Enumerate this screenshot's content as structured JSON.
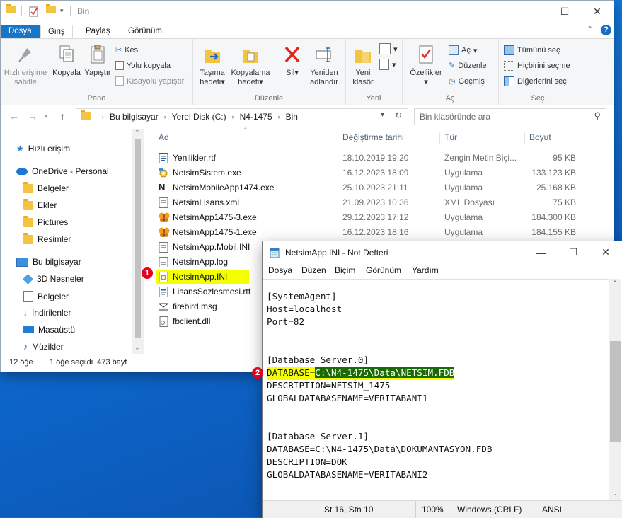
{
  "explorer": {
    "title": "Bin",
    "tabs": [
      "Dosya",
      "Giriş",
      "Paylaş",
      "Görünüm"
    ],
    "ribbon": {
      "pano": {
        "name": "Pano",
        "pin": "Hızlı erişime sabitle",
        "copy": "Kopyala",
        "paste": "Yapıştır",
        "cut": "Kes",
        "copy_path": "Yolu kopyala",
        "paste_shortcut": "Kısayolu yapıştır"
      },
      "duzenle": {
        "name": "Düzenle",
        "move_to": "Taşıma hedefi",
        "copy_to": "Kopyalama hedefi",
        "delete": "Sil",
        "rename": "Yeniden adlandır"
      },
      "yeni": {
        "name": "Yeni",
        "new_folder": "Yeni klasör"
      },
      "ac": {
        "name": "Aç",
        "properties": "Özellikler",
        "open": "Aç",
        "edit": "Düzenle",
        "history": "Geçmiş"
      },
      "sec": {
        "name": "Seç",
        "select_all": "Tümünü seç",
        "select_none": "Hiçbirini seçme",
        "invert": "Diğerlerini seç"
      }
    },
    "address": [
      "Bu bilgisayar",
      "Yerel Disk (C:)",
      "N4-1475",
      "Bin"
    ],
    "search_placeholder": "Bin klasöründe ara",
    "nav": {
      "quick": "Hızlı erişim",
      "onedrive": "OneDrive - Personal",
      "onedrive_items": [
        "Belgeler",
        "Ekler",
        "Pictures",
        "Resimler"
      ],
      "pc": "Bu bilgisayar",
      "pc_items": [
        "3D Nesneler",
        "Belgeler",
        "İndirilenler",
        "Masaüstü",
        "Müzikler"
      ]
    },
    "columns": {
      "name": "Ad",
      "date": "Değiştirme tarihi",
      "type": "Tür",
      "size": "Boyut"
    },
    "files": [
      {
        "name": "Yenilikler.rtf",
        "date": "18.10.2019 19:20",
        "type": "Zengin Metin Biçi...",
        "size": "95 KB"
      },
      {
        "name": "NetsimSistem.exe",
        "date": "16.12.2023 18:09",
        "type": "Uygulama",
        "size": "133.123 KB"
      },
      {
        "name": "NetsimMobileApp1474.exe",
        "date": "25.10.2023 21:11",
        "type": "Uygulama",
        "size": "25.168 KB"
      },
      {
        "name": "NetsimLisans.xml",
        "date": "21.09.2023 10:36",
        "type": "XML Dosyası",
        "size": "75 KB"
      },
      {
        "name": "NetsimApp1475-3.exe",
        "date": "29.12.2023 17:12",
        "type": "Uygulama",
        "size": "184.300 KB"
      },
      {
        "name": "NetsimApp1475-1.exe",
        "date": "16.12.2023 18:16",
        "type": "Uygulama",
        "size": "184.155 KB"
      },
      {
        "name": "NetsimApp.Mobil.INI",
        "date": "",
        "type": "",
        "size": ""
      },
      {
        "name": "NetsimApp.log",
        "date": "",
        "type": "",
        "size": ""
      },
      {
        "name": "NetsimApp.INI",
        "date": "",
        "type": "",
        "size": ""
      },
      {
        "name": "LisansSozlesmesi.rtf",
        "date": "",
        "type": "",
        "size": ""
      },
      {
        "name": "firebird.msg",
        "date": "",
        "type": "",
        "size": ""
      },
      {
        "name": "fbclient.dll",
        "date": "",
        "type": "",
        "size": ""
      }
    ],
    "status": {
      "count": "12 öğe",
      "selection": "1 öğe seçildi  473 bayt"
    }
  },
  "badges": {
    "one": "1",
    "two": "2"
  },
  "notepad": {
    "title": "NetsimApp.INI - Not Defteri",
    "menu": [
      "Dosya",
      "Düzen",
      "Biçim",
      "Görünüm",
      "Yardım"
    ],
    "lines": [
      "[SystemAgent]",
      "Host=localhost",
      "Port=82",
      "",
      "",
      "[Database Server.0]",
      "DATABASE=",
      "DESCRIPTION=NETSİM_1475",
      "GLOBALDATABASENAME=VERITABANI1",
      "",
      "",
      "[Database Server.1]",
      "DATABASE=C:\\N4-1475\\Data\\DOKUMANTASYON.FDB",
      "DESCRIPTION=DOK",
      "GLOBALDATABASENAME=VERITABANI2"
    ],
    "selected_text": "C:\\N4-1475\\Data\\NETSIM.FDB",
    "status": {
      "position": "St 16, Stn 10",
      "zoom": "100%",
      "eol": "Windows (CRLF)",
      "encoding": "ANSI"
    }
  },
  "colors": {
    "accent": "#1975c5",
    "highlight": "#f4ff00",
    "selection": "#1a6b05",
    "badge": "#e5001c"
  }
}
